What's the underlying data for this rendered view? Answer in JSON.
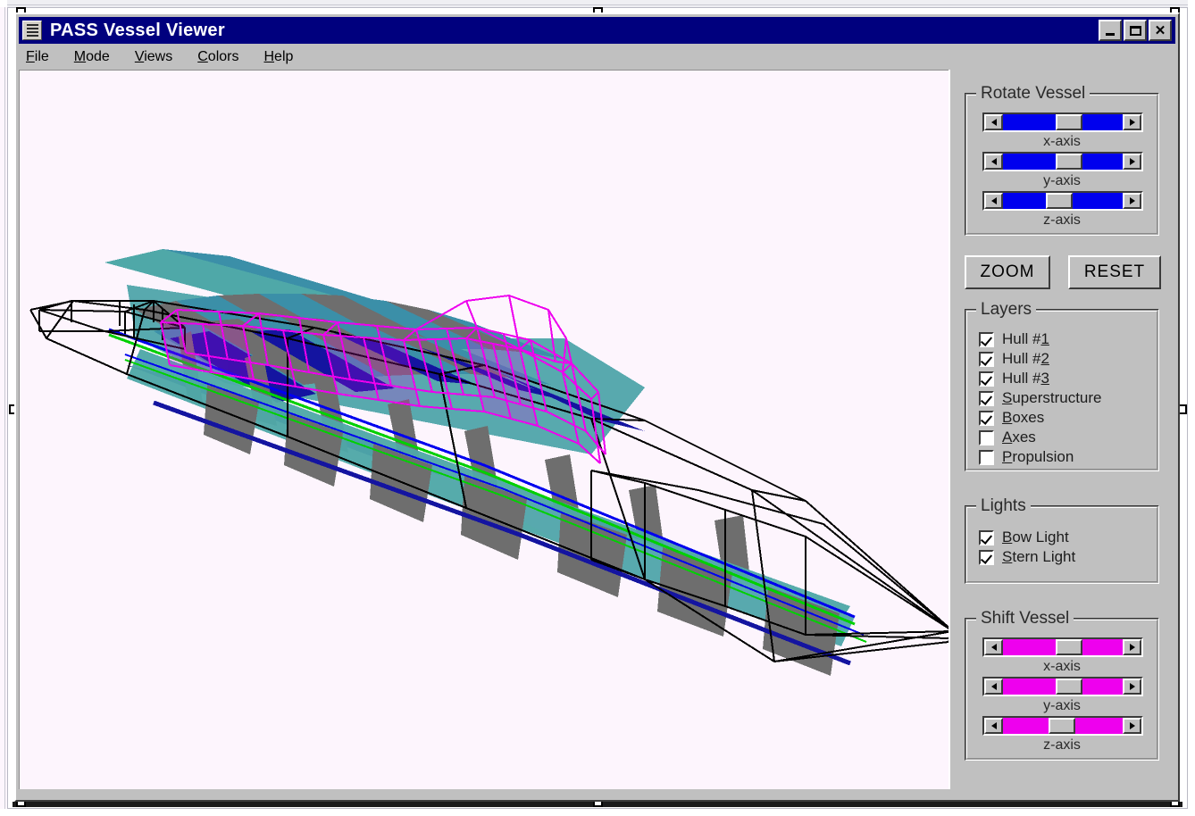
{
  "window": {
    "title": "PASS Vessel Viewer",
    "sysmenu_icon": "document-lines-icon",
    "buttons": {
      "minimize": "minimize-icon",
      "maximize": "maximize-icon",
      "close": "close-icon"
    }
  },
  "menubar": {
    "items": [
      {
        "label": "File",
        "mnemonic": "F"
      },
      {
        "label": "Mode",
        "mnemonic": "M"
      },
      {
        "label": "Views",
        "mnemonic": "V"
      },
      {
        "label": "Colors",
        "mnemonic": "C"
      },
      {
        "label": "Help",
        "mnemonic": "H"
      }
    ]
  },
  "panel": {
    "rotate": {
      "title": "Rotate Vessel",
      "accent": "#0000ee",
      "sliders": [
        {
          "label": "x-axis",
          "thumb_pct": 48
        },
        {
          "label": "y-axis",
          "thumb_pct": 48
        },
        {
          "label": "z-axis",
          "thumb_pct": 40
        }
      ]
    },
    "actions": {
      "zoom_label": "ZOOM",
      "reset_label": "RESET"
    },
    "layers": {
      "title": "Layers",
      "items": [
        {
          "label": "Hull #1",
          "mnemonic": "1",
          "checked": true
        },
        {
          "label": "Hull #2",
          "mnemonic": "2",
          "checked": true
        },
        {
          "label": "Hull #3",
          "mnemonic": "3",
          "checked": true
        },
        {
          "label": "Superstructure",
          "mnemonic": "S",
          "checked": true
        },
        {
          "label": "Boxes",
          "mnemonic": "B",
          "checked": true
        },
        {
          "label": "Axes",
          "mnemonic": "A",
          "checked": false
        },
        {
          "label": "Propulsion",
          "mnemonic": "P",
          "checked": false
        }
      ]
    },
    "lights": {
      "title": "Lights",
      "items": [
        {
          "label": "Bow Light",
          "mnemonic": "B",
          "checked": true
        },
        {
          "label": "Stern Light",
          "mnemonic": "S",
          "checked": true
        }
      ]
    },
    "shift": {
      "title": "Shift Vessel",
      "accent": "#ee00ee",
      "sliders": [
        {
          "label": "x-axis",
          "thumb_pct": 48
        },
        {
          "label": "y-axis",
          "thumb_pct": 48
        },
        {
          "label": "z-axis",
          "thumb_pct": 42
        }
      ]
    }
  },
  "viewport": {
    "background": "#fdf5fd",
    "model": "3d-vessel-wireframe",
    "colors": {
      "hull_teal": "#4fa8a8",
      "hull_steel": "#3b8fa8",
      "hull_navy": "#1414a0",
      "bulkhead_gray": "#6e6e6e",
      "wireframe_black": "#000000",
      "boxes_magenta": "#ee00ee",
      "waterline_green": "#00d000",
      "waterline_blue": "#0000ee"
    }
  },
  "selection": {
    "handles": 8,
    "style": "ole-object-selected"
  }
}
